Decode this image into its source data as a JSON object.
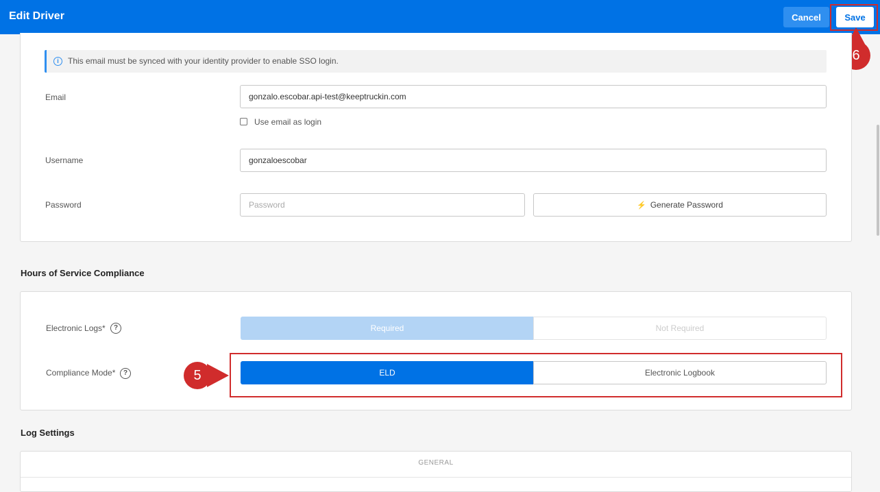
{
  "header": {
    "title": "Edit Driver",
    "cancel_label": "Cancel",
    "save_label": "Save"
  },
  "sso_notice": {
    "text": "This email must be synced with your identity provider to enable SSO login.",
    "icon": "info-icon"
  },
  "account": {
    "email_label": "Email",
    "email_value": "gonzalo.escobar.api-test@keeptruckin.com",
    "use_email_login_label": "Use email as login",
    "use_email_login_checked": false,
    "username_label": "Username",
    "username_value": "gonzaloescobar",
    "password_label": "Password",
    "password_placeholder": "Password",
    "generate_password_label": "Generate Password"
  },
  "hos": {
    "section_title": "Hours of Service Compliance",
    "electronic_logs_label": "Electronic Logs*",
    "electronic_logs_options": [
      "Required",
      "Not Required"
    ],
    "electronic_logs_selected": "Required",
    "compliance_mode_label": "Compliance Mode*",
    "compliance_mode_options": [
      "ELD",
      "Electronic Logbook"
    ],
    "compliance_mode_selected": "ELD",
    "help_glyph": "?"
  },
  "log_settings": {
    "section_title": "Log Settings",
    "general_label": "GENERAL"
  },
  "annotations": {
    "step5": "5",
    "step6": "6",
    "highlight_color": "#d02c2c"
  },
  "colors": {
    "primary": "#0072e5",
    "primary_light": "#b3d4f5"
  }
}
